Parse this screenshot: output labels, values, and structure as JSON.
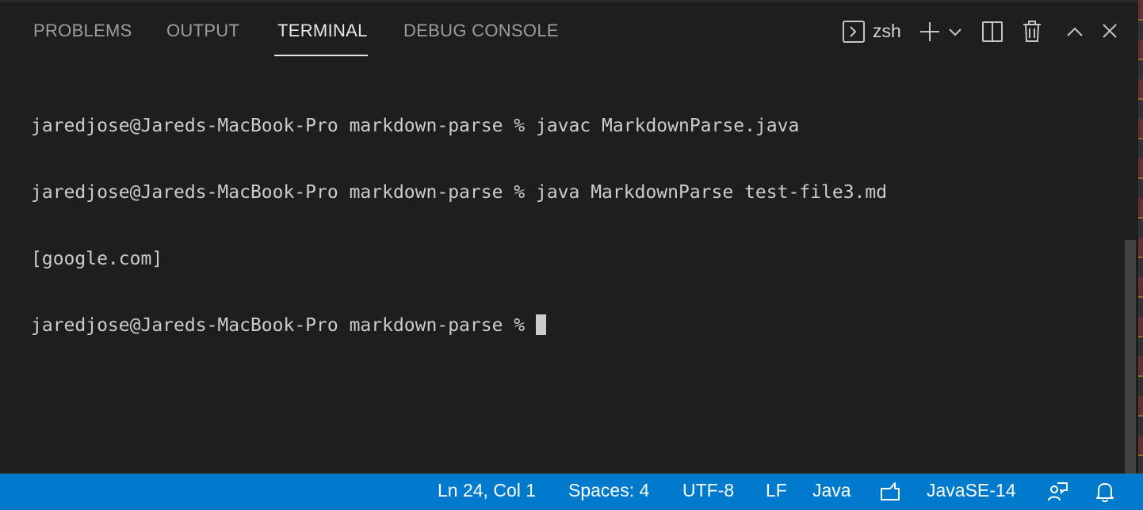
{
  "panel": {
    "tabs": [
      {
        "label": "PROBLEMS"
      },
      {
        "label": "OUTPUT"
      },
      {
        "label": "TERMINAL"
      },
      {
        "label": "DEBUG CONSOLE"
      }
    ],
    "active_tab": "TERMINAL",
    "shell_name": "zsh",
    "icons": [
      "terminal-icon",
      "plus-icon",
      "chevron-down-icon",
      "split-icon",
      "trash-icon",
      "chevron-up-icon",
      "close-icon"
    ]
  },
  "terminal": {
    "lines": [
      "jaredjose@Jareds-MacBook-Pro markdown-parse % javac MarkdownParse.java",
      "jaredjose@Jareds-MacBook-Pro markdown-parse % java MarkdownParse test-file3.md",
      "[google.com]",
      "jaredjose@Jareds-MacBook-Pro markdown-parse % "
    ]
  },
  "statusbar": {
    "cursor_position": "Ln 24, Col 1",
    "indentation": "Spaces: 4",
    "encoding": "UTF-8",
    "line_ending": "LF",
    "language": "Java",
    "java_runtime": "JavaSE-14",
    "icons": [
      "feedback-icon",
      "live-share-icon",
      "bell-icon"
    ]
  },
  "colors": {
    "background": "#1e1e1e",
    "statusbar": "#007acc",
    "active_tab": "#e7e7e7",
    "inactive_tab": "#9d9d9d"
  }
}
